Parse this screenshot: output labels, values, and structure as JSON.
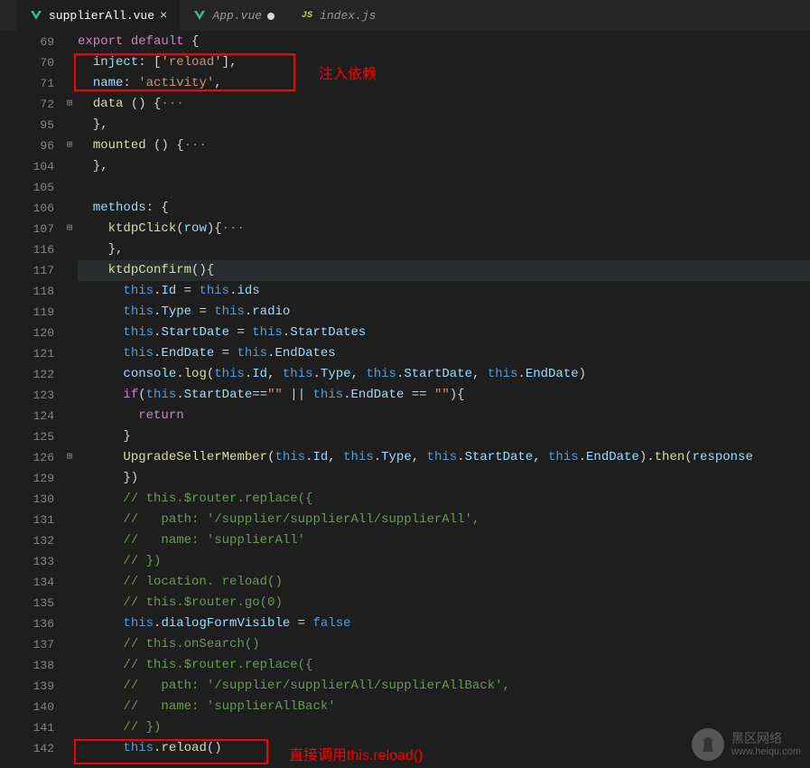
{
  "tabs": [
    {
      "name": "supplierAll.vue",
      "icon": "vue",
      "active": true,
      "modified": false
    },
    {
      "name": "App.vue",
      "icon": "vue",
      "active": false,
      "modified": true
    },
    {
      "name": "index.js",
      "icon": "js",
      "active": false,
      "modified": false
    }
  ],
  "annotations": {
    "label1": "注入依赖",
    "label2": "直接调用this.reload()"
  },
  "watermark": {
    "title": "黑区网络",
    "url": "www.heiqu.com"
  },
  "lines": [
    {
      "num": "69",
      "fold": "",
      "tokens": [
        [
          "kw",
          "export"
        ],
        [
          "punct",
          " "
        ],
        [
          "kw",
          "default"
        ],
        [
          "punct",
          " {"
        ]
      ]
    },
    {
      "num": "70",
      "fold": "",
      "tokens": [
        [
          "punct",
          "  "
        ],
        [
          "prop",
          "inject"
        ],
        [
          "punct",
          ": ["
        ],
        [
          "str",
          "'reload'"
        ],
        [
          "punct",
          "],"
        ]
      ]
    },
    {
      "num": "71",
      "fold": "",
      "tokens": [
        [
          "punct",
          "  "
        ],
        [
          "prop",
          "name"
        ],
        [
          "punct",
          ": "
        ],
        [
          "str",
          "'activity'"
        ],
        [
          "punct",
          ","
        ]
      ]
    },
    {
      "num": "72",
      "fold": "+",
      "tokens": [
        [
          "punct",
          "  "
        ],
        [
          "fn",
          "data"
        ],
        [
          "punct",
          " () {"
        ],
        [
          "dots",
          "···"
        ]
      ]
    },
    {
      "num": "95",
      "fold": "",
      "tokens": [
        [
          "punct",
          "  },"
        ]
      ]
    },
    {
      "num": "96",
      "fold": "+",
      "tokens": [
        [
          "punct",
          "  "
        ],
        [
          "fn",
          "mounted"
        ],
        [
          "punct",
          " () {"
        ],
        [
          "dots",
          "···"
        ]
      ]
    },
    {
      "num": "104",
      "fold": "",
      "tokens": [
        [
          "punct",
          "  },"
        ]
      ]
    },
    {
      "num": "105",
      "fold": "",
      "tokens": [
        [
          "punct",
          ""
        ]
      ]
    },
    {
      "num": "106",
      "fold": "",
      "tokens": [
        [
          "punct",
          "  "
        ],
        [
          "prop",
          "methods"
        ],
        [
          "punct",
          ": {"
        ]
      ]
    },
    {
      "num": "107",
      "fold": "+",
      "tokens": [
        [
          "punct",
          "    "
        ],
        [
          "fn",
          "ktdpClick"
        ],
        [
          "punct",
          "("
        ],
        [
          "var",
          "row"
        ],
        [
          "punct",
          "){"
        ],
        [
          "dots",
          "···"
        ]
      ]
    },
    {
      "num": "116",
      "fold": "",
      "tokens": [
        [
          "punct",
          "    },"
        ]
      ]
    },
    {
      "num": "117",
      "fold": "",
      "hl": true,
      "tokens": [
        [
          "punct",
          "    "
        ],
        [
          "fn",
          "ktdpConfirm"
        ],
        [
          "punct",
          "(){"
        ]
      ]
    },
    {
      "num": "118",
      "fold": "",
      "tokens": [
        [
          "punct",
          "      "
        ],
        [
          "this",
          "this"
        ],
        [
          "punct",
          "."
        ],
        [
          "prop",
          "Id"
        ],
        [
          "punct",
          " = "
        ],
        [
          "this",
          "this"
        ],
        [
          "punct",
          "."
        ],
        [
          "prop",
          "ids"
        ]
      ]
    },
    {
      "num": "119",
      "fold": "",
      "tokens": [
        [
          "punct",
          "      "
        ],
        [
          "this",
          "this"
        ],
        [
          "punct",
          "."
        ],
        [
          "prop",
          "Type"
        ],
        [
          "punct",
          " = "
        ],
        [
          "this",
          "this"
        ],
        [
          "punct",
          "."
        ],
        [
          "prop",
          "radio"
        ]
      ]
    },
    {
      "num": "120",
      "fold": "",
      "tokens": [
        [
          "punct",
          "      "
        ],
        [
          "this",
          "this"
        ],
        [
          "punct",
          "."
        ],
        [
          "prop",
          "StartDate"
        ],
        [
          "punct",
          " = "
        ],
        [
          "this",
          "this"
        ],
        [
          "punct",
          "."
        ],
        [
          "prop",
          "StartDates"
        ]
      ]
    },
    {
      "num": "121",
      "fold": "",
      "tokens": [
        [
          "punct",
          "      "
        ],
        [
          "this",
          "this"
        ],
        [
          "punct",
          "."
        ],
        [
          "prop",
          "EndDate"
        ],
        [
          "punct",
          " = "
        ],
        [
          "this",
          "this"
        ],
        [
          "punct",
          "."
        ],
        [
          "prop",
          "EndDates"
        ]
      ]
    },
    {
      "num": "122",
      "fold": "",
      "tokens": [
        [
          "punct",
          "      "
        ],
        [
          "var",
          "console"
        ],
        [
          "punct",
          "."
        ],
        [
          "fn",
          "log"
        ],
        [
          "punct",
          "("
        ],
        [
          "this",
          "this"
        ],
        [
          "punct",
          "."
        ],
        [
          "prop",
          "Id"
        ],
        [
          "punct",
          ", "
        ],
        [
          "this",
          "this"
        ],
        [
          "punct",
          "."
        ],
        [
          "prop",
          "Type"
        ],
        [
          "punct",
          ", "
        ],
        [
          "this",
          "this"
        ],
        [
          "punct",
          "."
        ],
        [
          "prop",
          "StartDate"
        ],
        [
          "punct",
          ", "
        ],
        [
          "this",
          "this"
        ],
        [
          "punct",
          "."
        ],
        [
          "prop",
          "EndDate"
        ],
        [
          "punct",
          ")"
        ]
      ]
    },
    {
      "num": "123",
      "fold": "",
      "tokens": [
        [
          "punct",
          "      "
        ],
        [
          "kw",
          "if"
        ],
        [
          "punct",
          "("
        ],
        [
          "this",
          "this"
        ],
        [
          "punct",
          "."
        ],
        [
          "prop",
          "StartDate"
        ],
        [
          "punct",
          "=="
        ],
        [
          "str",
          "\"\""
        ],
        [
          "punct",
          " || "
        ],
        [
          "this",
          "this"
        ],
        [
          "punct",
          "."
        ],
        [
          "prop",
          "EndDate"
        ],
        [
          "punct",
          " == "
        ],
        [
          "str",
          "\"\""
        ],
        [
          "punct",
          "){"
        ]
      ]
    },
    {
      "num": "124",
      "fold": "",
      "tokens": [
        [
          "punct",
          "        "
        ],
        [
          "kw",
          "return"
        ]
      ]
    },
    {
      "num": "125",
      "fold": "",
      "tokens": [
        [
          "punct",
          "      }"
        ]
      ]
    },
    {
      "num": "126",
      "fold": "+",
      "tokens": [
        [
          "punct",
          "      "
        ],
        [
          "fn",
          "UpgradeSellerMember"
        ],
        [
          "punct",
          "("
        ],
        [
          "this",
          "this"
        ],
        [
          "punct",
          "."
        ],
        [
          "prop",
          "Id"
        ],
        [
          "punct",
          ", "
        ],
        [
          "this",
          "this"
        ],
        [
          "punct",
          "."
        ],
        [
          "prop",
          "Type"
        ],
        [
          "punct",
          ", "
        ],
        [
          "this",
          "this"
        ],
        [
          "punct",
          "."
        ],
        [
          "prop",
          "StartDate"
        ],
        [
          "punct",
          ", "
        ],
        [
          "this",
          "this"
        ],
        [
          "punct",
          "."
        ],
        [
          "prop",
          "EndDate"
        ],
        [
          "punct",
          ")."
        ],
        [
          "fn",
          "then"
        ],
        [
          "punct",
          "("
        ],
        [
          "var",
          "response"
        ],
        [
          "punct",
          " "
        ]
      ]
    },
    {
      "num": "129",
      "fold": "",
      "tokens": [
        [
          "punct",
          "      })"
        ]
      ]
    },
    {
      "num": "130",
      "fold": "",
      "tokens": [
        [
          "punct",
          "      "
        ],
        [
          "cmt",
          "// this.$router.replace({"
        ]
      ]
    },
    {
      "num": "131",
      "fold": "",
      "tokens": [
        [
          "punct",
          "      "
        ],
        [
          "cmt",
          "//   path: '/supplier/supplierAll/supplierAll',"
        ]
      ]
    },
    {
      "num": "132",
      "fold": "",
      "tokens": [
        [
          "punct",
          "      "
        ],
        [
          "cmt",
          "//   name: 'supplierAll'"
        ]
      ]
    },
    {
      "num": "133",
      "fold": "",
      "tokens": [
        [
          "punct",
          "      "
        ],
        [
          "cmt",
          "// })"
        ]
      ]
    },
    {
      "num": "134",
      "fold": "",
      "tokens": [
        [
          "punct",
          "      "
        ],
        [
          "cmt",
          "// location. reload()"
        ]
      ]
    },
    {
      "num": "135",
      "fold": "",
      "tokens": [
        [
          "punct",
          "      "
        ],
        [
          "cmt",
          "// this.$router.go(0)"
        ]
      ]
    },
    {
      "num": "136",
      "fold": "",
      "tokens": [
        [
          "punct",
          "      "
        ],
        [
          "this",
          "this"
        ],
        [
          "punct",
          "."
        ],
        [
          "prop",
          "dialogFormVisible"
        ],
        [
          "punct",
          " = "
        ],
        [
          "kw2",
          "false"
        ]
      ]
    },
    {
      "num": "137",
      "fold": "",
      "tokens": [
        [
          "punct",
          "      "
        ],
        [
          "cmt",
          "// this.onSearch()"
        ]
      ]
    },
    {
      "num": "138",
      "fold": "",
      "tokens": [
        [
          "punct",
          "      "
        ],
        [
          "cmt",
          "// this.$router.replace({"
        ]
      ]
    },
    {
      "num": "139",
      "fold": "",
      "tokens": [
        [
          "punct",
          "      "
        ],
        [
          "cmt",
          "//   path: '/supplier/supplierAll/supplierAllBack',"
        ]
      ]
    },
    {
      "num": "140",
      "fold": "",
      "tokens": [
        [
          "punct",
          "      "
        ],
        [
          "cmt",
          "//   name: 'supplierAllBack'"
        ]
      ]
    },
    {
      "num": "141",
      "fold": "",
      "tokens": [
        [
          "punct",
          "      "
        ],
        [
          "cmt",
          "// })"
        ]
      ]
    },
    {
      "num": "142",
      "fold": "",
      "tokens": [
        [
          "punct",
          "      "
        ],
        [
          "this",
          "this"
        ],
        [
          "punct",
          "."
        ],
        [
          "fn",
          "reload"
        ],
        [
          "punct",
          "()"
        ]
      ]
    }
  ]
}
